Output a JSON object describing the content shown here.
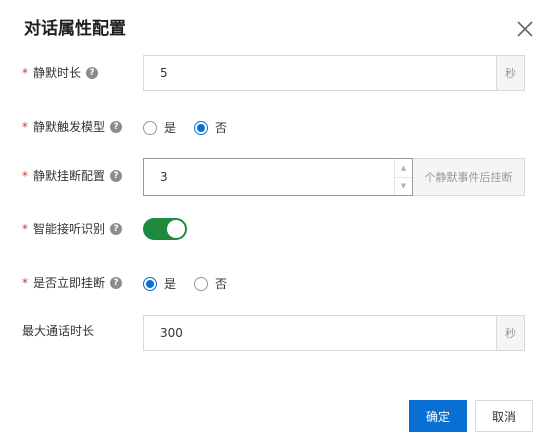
{
  "dialog": {
    "title": "对话属性配置",
    "close_icon": "close-icon"
  },
  "fields": {
    "silence_duration": {
      "label": "静默时长",
      "required": "*",
      "help": "?",
      "value": "5",
      "suffix": "秒"
    },
    "silence_trigger_model": {
      "label": "静默触发模型",
      "required": "*",
      "help": "?",
      "options": [
        "是",
        "否"
      ],
      "selected": "否"
    },
    "silence_hangup_config": {
      "label": "静默挂断配置",
      "required": "*",
      "help": "?",
      "value": "3",
      "suffix": "个静默事件后挂断"
    },
    "smart_answer_detection": {
      "label": "智能接听识别",
      "required": "*",
      "help": "?",
      "enabled": true
    },
    "hangup_immediately": {
      "label": "是否立即挂断",
      "required": "*",
      "help": "?",
      "options": [
        "是",
        "否"
      ],
      "selected": "是"
    },
    "max_call_duration": {
      "label": "最大通话时长",
      "value": "300",
      "suffix": "秒"
    }
  },
  "buttons": {
    "confirm": "确定",
    "cancel": "取消"
  },
  "colors": {
    "primary": "#0a6fd3",
    "switch_on": "#1f8a3e",
    "required": "#e0362c"
  }
}
